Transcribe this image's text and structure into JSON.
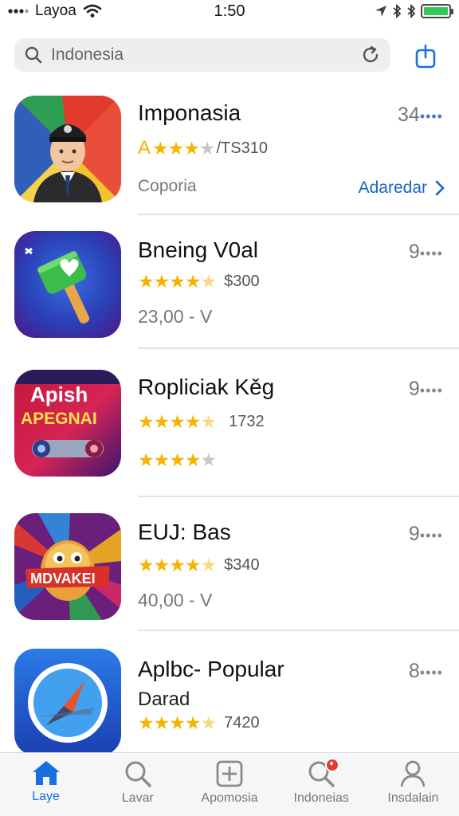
{
  "status_bar": {
    "carrier": "Layoa",
    "time": "1:50",
    "battery_level": 1.0
  },
  "search": {
    "placeholder": "Indonesia"
  },
  "apps": [
    {
      "name": "Imponasia",
      "rank": "34",
      "rank_dots": "••••",
      "rating_prefix": "A",
      "stars": 4,
      "rating_text": "/TS310",
      "subtitle": "Coporia",
      "action_label": "Adaredar",
      "icon": "police-avatar-icon"
    },
    {
      "name": "Bneing V0al",
      "rank": "9",
      "rank_dots": "••••",
      "stars": 4.5,
      "rating_text": "$300",
      "subtitle": "23,00 - V",
      "icon": "hammer-game-icon"
    },
    {
      "name": "Ropliciak Kěg",
      "rank": "9",
      "rank_dots": "••••",
      "stars": 4.5,
      "rating_text": "1732",
      "stars_second": 4,
      "icon_text_1": "Apish",
      "icon_text_2": "APEGNAI",
      "icon": "arcade-game-icon"
    },
    {
      "name": "EUJ: Bas",
      "rank": "9",
      "rank_dots": "••••",
      "stars": 4.5,
      "rating_text": "$340",
      "subtitle": "40,00 - V",
      "icon_text": "MDVAKEI",
      "icon": "monster-game-icon"
    },
    {
      "name": "Aplbc- Popular",
      "rank": "8",
      "rank_dots": "••••",
      "subtitle": "Darad",
      "stars": 4.5,
      "rating_text": "7420",
      "icon": "compass-icon"
    }
  ],
  "tabs": [
    {
      "label": "Laye",
      "icon": "home-icon",
      "active": true
    },
    {
      "label": "Lavar",
      "icon": "search-icon",
      "active": false
    },
    {
      "label": "Apomosia",
      "icon": "plus-square-icon",
      "active": false
    },
    {
      "label": "Indoneias",
      "icon": "search-badge-icon",
      "active": false
    },
    {
      "label": "Insdalain",
      "icon": "person-icon",
      "active": false
    }
  ],
  "colors": {
    "accent": "#1a6fe0",
    "star": "#f4b400",
    "badge": "#e53935"
  }
}
